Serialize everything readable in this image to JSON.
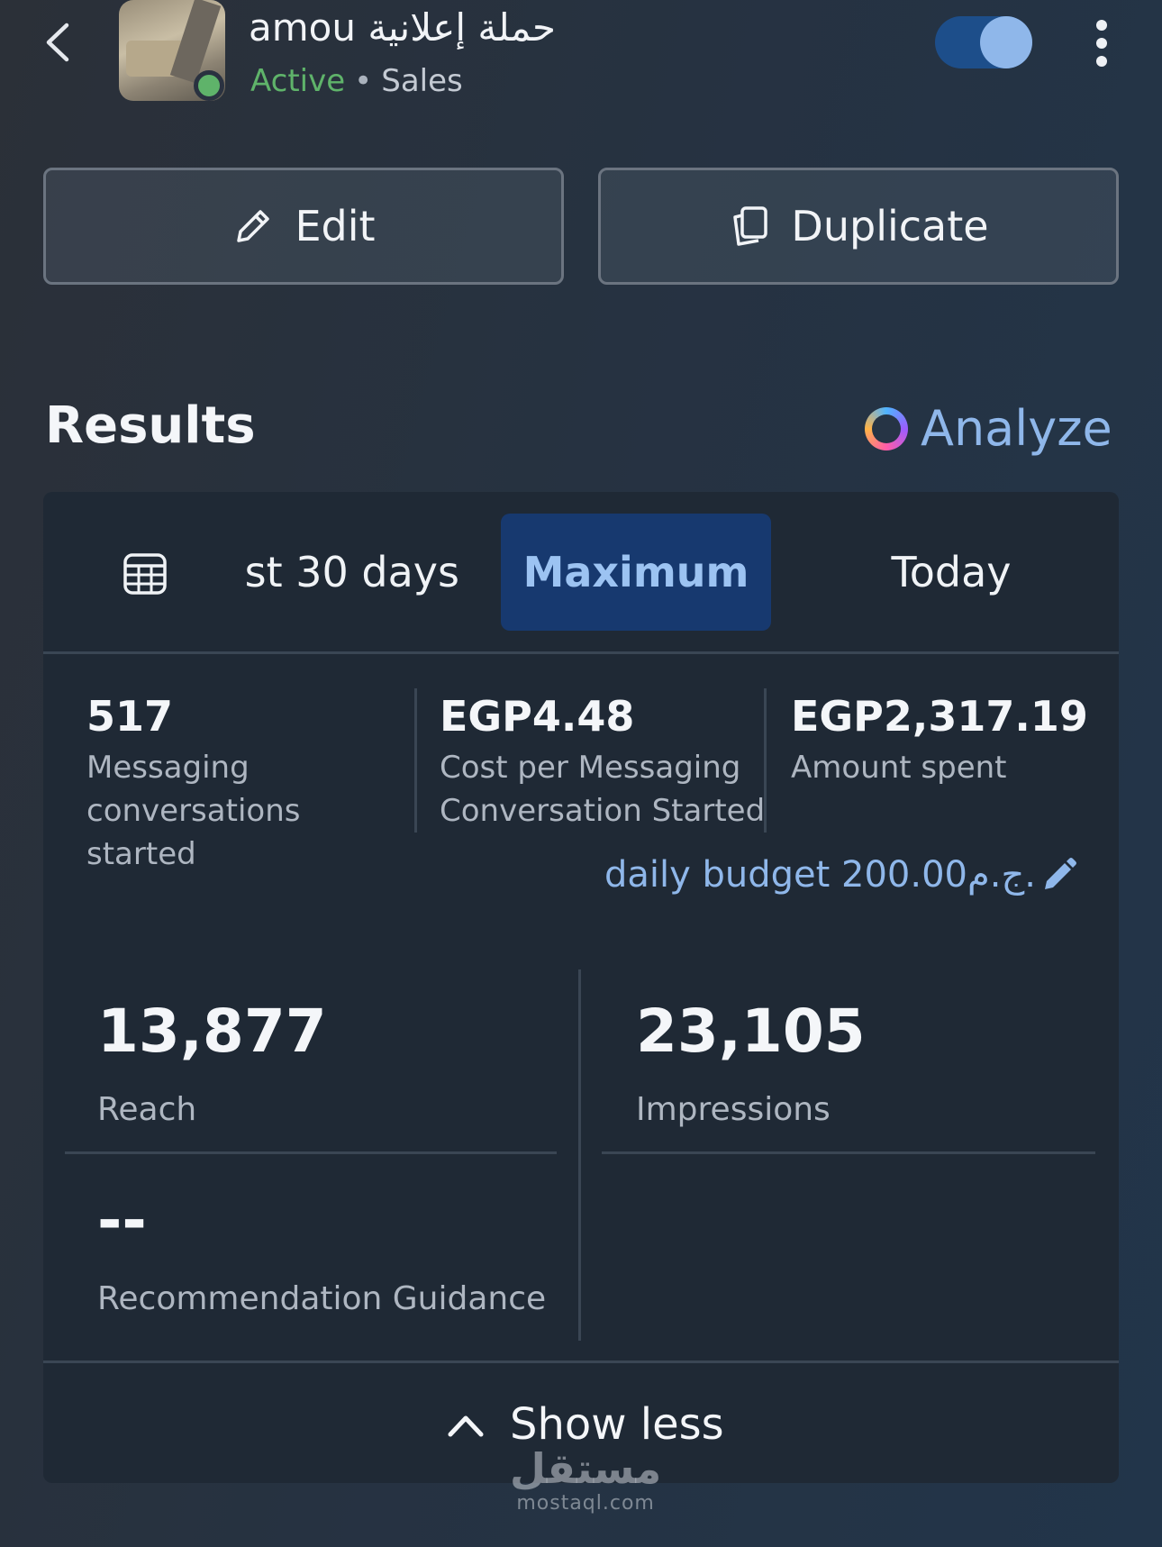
{
  "header": {
    "title": "amou حملة إعلانية",
    "status": "Active",
    "separator": "•",
    "objective": "Sales",
    "toggle_on": true
  },
  "actions": {
    "edit_label": "Edit",
    "duplicate_label": "Duplicate"
  },
  "results": {
    "title": "Results",
    "analyze_label": "Analyze",
    "tabs": [
      {
        "label": "st 30 days",
        "selected": false
      },
      {
        "label": "Maximum",
        "selected": true
      },
      {
        "label": "Today",
        "selected": false
      }
    ],
    "metrics": [
      {
        "value": "517",
        "label": "Messaging conversations started"
      },
      {
        "value": "EGP4.48",
        "label": "Cost per Messaging Conversation Started"
      },
      {
        "value": "EGP2,317.19",
        "label": "Amount spent"
      }
    ],
    "budget_text": "daily budget 200.00ج.م.",
    "reach": {
      "value": "13,877",
      "label": "Reach"
    },
    "impressions": {
      "value": "23,105",
      "label": "Impressions"
    },
    "recommendation": {
      "value": "--",
      "label": "Recommendation Guidance"
    },
    "show_less_label": "Show less"
  },
  "watermark": {
    "arabic": "مستقل",
    "latin": "mostaql.com"
  },
  "colors": {
    "accent": "#8fb7ea",
    "active_green": "#5fb36a",
    "selected_tab_bg": "#17396f"
  }
}
